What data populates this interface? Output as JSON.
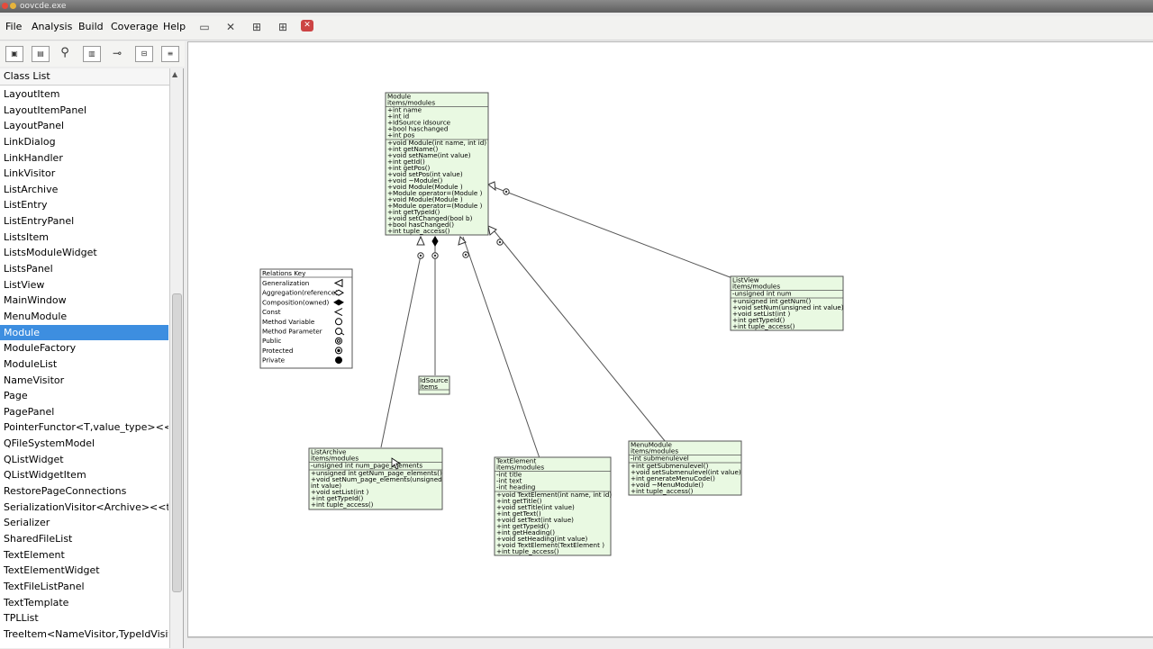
{
  "titlebar": {
    "title": "oovcde.exe"
  },
  "menu": [
    "File",
    "Analysis",
    "Build",
    "Coverage",
    "Help"
  ],
  "sidebar": {
    "header": "Class List",
    "selected_index": 15,
    "items": [
      "LayoutItem",
      "LayoutItemPanel",
      "LayoutPanel",
      "LinkDialog",
      "LinkHandler",
      "LinkVisitor",
      "ListArchive",
      "ListEntry",
      "ListEntryPanel",
      "ListsItem",
      "ListsModuleWidget",
      "ListsPanel",
      "ListView",
      "MainWindow",
      "MenuModule",
      "Module",
      "ModuleFactory",
      "ModuleList",
      "NameVisitor",
      "Page",
      "PagePanel",
      "PointerFunctor<T,value_type><<ten",
      "QFileSystemModel",
      "QListWidget",
      "QListWidgetItem",
      "RestorePageConnections",
      "SerializationVisitor<Archive><<temp",
      "Serializer",
      "SharedFileList",
      "TextElement",
      "TextElementWidget",
      "TextFileListPanel",
      "TextTemplate",
      "TPLList",
      "TreeItem<NameVisitor,TypeIdVisitor,I"
    ]
  },
  "diagram": {
    "module": {
      "name": "Module",
      "pkg": "items/modules",
      "attrs": [
        "+int name",
        "+int id",
        "+IdSource idsource",
        "+bool haschanged",
        "+int pos"
      ],
      "ops": [
        "+void Module(int name, int id)",
        "+int getName()",
        "+void setName(int value)",
        "+int getId()",
        "+int getPos()",
        "+void setPos(int value)",
        "+void ~Module()",
        "+void Module(Module )",
        "+Module operator=(Module )",
        "+void Module(Module )",
        "+Module operator=(Module )",
        "+int getTypeId()",
        "+void setChanged(bool b)",
        "+bool hasChanged()",
        "+int tuple_access()"
      ]
    },
    "listview": {
      "name": "ListView",
      "pkg": "items/modules",
      "attrs": [
        "-unsigned int num"
      ],
      "ops": [
        "+unsigned int getNum()",
        "+void setNum(unsigned int value)",
        "+void setList(int )",
        "+int getTypeId()",
        "+int tuple_access()"
      ]
    },
    "relations": {
      "title": "Relations Key",
      "rows": [
        "Generalization",
        "Aggregation(reference)",
        "Composition(owned)",
        "Const",
        "Method Variable",
        "Method Parameter",
        "Public",
        "Protected",
        "Private"
      ]
    },
    "idsource": {
      "name": "IdSource",
      "pkg": "items"
    },
    "listarchive": {
      "name": "ListArchive",
      "pkg": "items/modules",
      "attrs": [
        "-unsigned int num_page_elements"
      ],
      "ops": [
        "+unsigned int getNum_page_elements()",
        "+void setNum_page_elements(unsigned",
        "  int value)",
        "+void setList(int )",
        "+int getTypeId()",
        "+int tuple_access()"
      ]
    },
    "textelement": {
      "name": "TextElement",
      "pkg": "items/modules",
      "attrs": [
        "-int title",
        "-int text",
        "-int heading"
      ],
      "ops": [
        "+void TextElement(int name, int id)",
        "+int getTitle()",
        "+void setTitle(int value)",
        "+int getText()",
        "+void setText(int value)",
        "+int getTypeId()",
        "+int getHeading()",
        "+void setHeading(int value)",
        "+void TextElement(TextElement )",
        "+int tuple_access()"
      ]
    },
    "menumodule": {
      "name": "MenuModule",
      "pkg": "items/modules",
      "attrs": [
        "-int submenulevel"
      ],
      "ops": [
        "+int getSubmenulevel()",
        "+void setSubmenulevel(int value)",
        "+int generateMenuCode()",
        "+void ~MenuModule()",
        "+int tuple_access()"
      ]
    }
  },
  "colors": {
    "class_fill": "#e9f9e2",
    "selection": "#3d8ee0"
  }
}
